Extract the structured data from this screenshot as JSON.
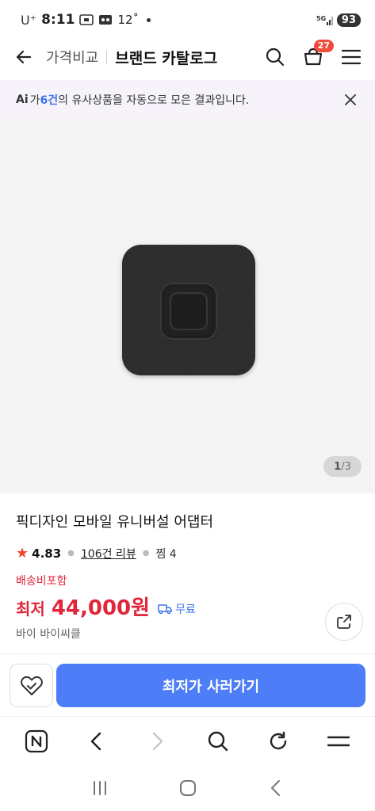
{
  "status_bar": {
    "carrier": "U⁺",
    "time": "8:11",
    "temperature": "12˚",
    "network": "5G",
    "battery": "93"
  },
  "header": {
    "compare_label": "가격비교",
    "title": "브랜드 카탈로그",
    "cart_count": "27"
  },
  "ai_banner": {
    "ai_mark": "Ai",
    "prefix": "가 ",
    "count": "6건",
    "suffix": "의 유사상품을 자동으로 모은 결과입니다."
  },
  "gallery": {
    "current": "1",
    "separator": " / ",
    "total": "3"
  },
  "product": {
    "title": "픽디자인 모바일 유니버설 어댑터",
    "rating": "4.83",
    "reviews": "106건 리뷰",
    "wishes": "찜 4",
    "ship_note": "배송비포함",
    "price_label": "최저",
    "price": "44,000원",
    "shipping": "무료",
    "seller": "바이 바이씨클"
  },
  "cta": {
    "buy_label": "최저가 사러가기"
  },
  "icons": {
    "back": "arrow-left-icon",
    "search": "search-icon",
    "cart": "cart-icon",
    "menu": "menu-icon",
    "close": "close-icon",
    "share": "share-icon",
    "wish": "heart-check-icon",
    "truck": "truck-icon"
  },
  "colors": {
    "accent": "#4d7ef7",
    "price": "#e0263a",
    "badge": "#f24b3d",
    "link": "#3b73f0",
    "banner_bg": "#f7f3fb"
  }
}
